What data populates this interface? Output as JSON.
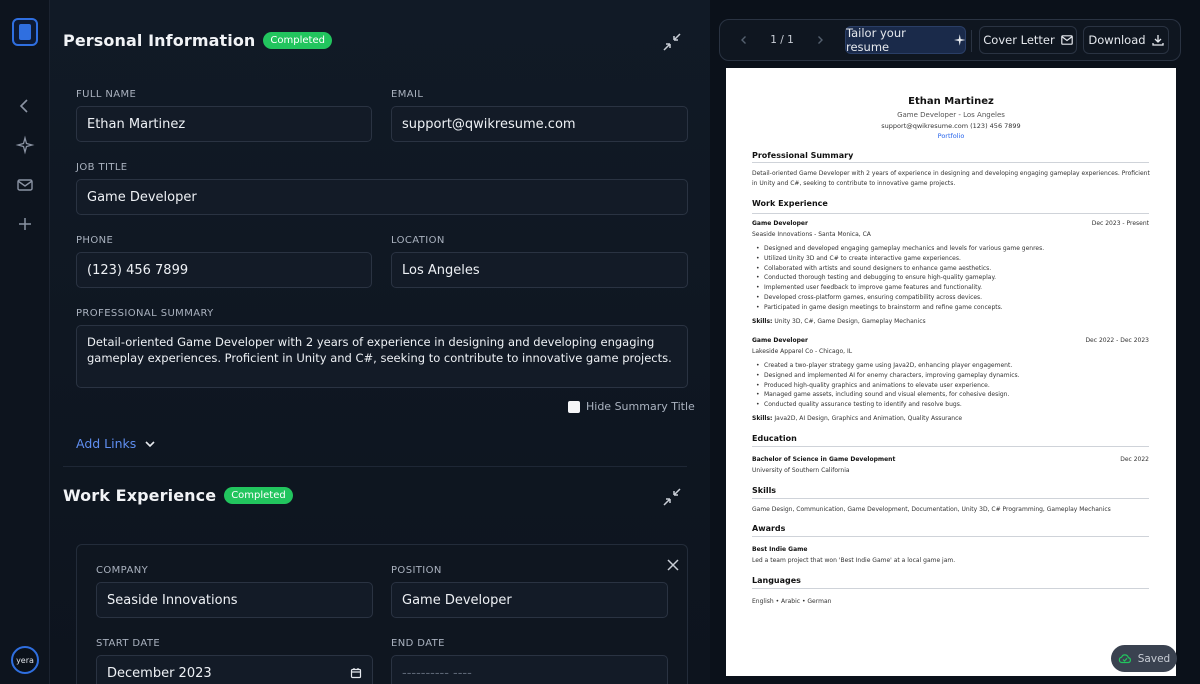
{
  "rail": {
    "avatar_text": "yera"
  },
  "personal": {
    "title": "Personal Information",
    "badge": "Completed",
    "full_name_label": "FULL NAME",
    "full_name": "Ethan Martinez",
    "email_label": "EMAIL",
    "email": "support@qwikresume.com",
    "job_title_label": "JOB TITLE",
    "job_title": "Game Developer",
    "phone_label": "PHONE",
    "phone": "(123) 456 7899",
    "location_label": "LOCATION",
    "location": "Los Angeles",
    "summary_label": "PROFESSIONAL SUMMARY",
    "summary": "Detail-oriented Game Developer with 2 years of experience in designing and developing engaging gameplay experiences. Proficient in Unity and C#, seeking to contribute to innovative game projects.",
    "hide_summary_label": "Hide Summary Title",
    "add_links_label": "Add Links"
  },
  "work": {
    "title": "Work Experience",
    "badge": "Completed",
    "company_label": "COMPANY",
    "company": "Seaside Innovations",
    "position_label": "POSITION",
    "position": "Game Developer",
    "start_label": "START DATE",
    "start": "December  2023",
    "end_label": "END DATE",
    "end_placeholder": "---------- ----"
  },
  "toolbar": {
    "page": "1 / 1",
    "tailor_label": "Tailor your resume",
    "cover_label": "Cover Letter",
    "download_label": "Download"
  },
  "resume": {
    "name": "Ethan Martinez",
    "subtitle": "Game Developer - Los Angeles",
    "contact": "support@qwikresume.com   (123) 456 7899",
    "portfolio": "Portfolio",
    "summary_h": "Professional Summary",
    "summary": "Detail-oriented Game Developer with 2 years of experience in designing and developing engaging gameplay experiences. Proficient in Unity and C#, seeking to contribute to innovative game projects.",
    "work_h": "Work Experience",
    "jobs": [
      {
        "title": "Game Developer",
        "company": "Seaside Innovations - Santa Monica, CA",
        "dates": "Dec 2023 - Present",
        "bullets": [
          "Designed and developed engaging gameplay mechanics and levels for various game genres.",
          "Utilized Unity 3D and C# to create interactive game experiences.",
          "Collaborated with artists and sound designers to enhance game aesthetics.",
          "Conducted thorough testing and debugging to ensure high-quality gameplay.",
          "Implemented user feedback to improve game features and functionality.",
          "Developed cross-platform games, ensuring compatibility across devices.",
          "Participated in game design meetings to brainstorm and refine game concepts."
        ],
        "skills_label": "Skills:",
        "skills": "Unity 3D, C#, Game Design, Gameplay Mechanics"
      },
      {
        "title": "Game Developer",
        "company": "Lakeside Apparel Co - Chicago, IL",
        "dates": "Dec 2022 - Dec 2023",
        "bullets": [
          "Created a two-player strategy game using Java2D, enhancing player engagement.",
          "Designed and implemented AI for enemy characters, improving gameplay dynamics.",
          "Produced high-quality graphics and animations to elevate user experience.",
          "Managed game assets, including sound and visual elements, for cohesive design.",
          "Conducted quality assurance testing to identify and resolve bugs."
        ],
        "skills_label": "Skills:",
        "skills": "Java2D, AI Design, Graphics and Animation, Quality Assurance"
      }
    ],
    "education_h": "Education",
    "degree": "Bachelor of Science in Game Development",
    "school": "University of Southern California",
    "edu_date": "Dec 2022",
    "skills_h": "Skills",
    "skills": "Game Design, Communication, Game Development, Documentation, Unity 3D, C# Programming, Gameplay Mechanics",
    "awards_h": "Awards",
    "award_title": "Best Indie Game",
    "award_desc": "Led a team project that won 'Best Indie Game' at a local game jam.",
    "languages_h": "Languages",
    "languages": "English • Arabic • German"
  },
  "status": {
    "saved_label": "Saved"
  },
  "colors": {
    "accent": "#2f6fe0",
    "badge": "#22c55e",
    "link": "#5f8ef0"
  }
}
